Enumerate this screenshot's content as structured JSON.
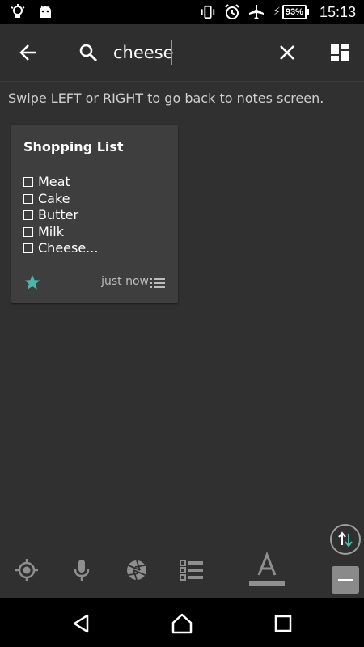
{
  "status_bar": {
    "left_icons": [
      "lightbulb-icon",
      "android-icon"
    ],
    "right_icons": [
      "vibrate-icon",
      "alarm-icon",
      "airplane-icon"
    ],
    "battery": "93%",
    "time": "15:13"
  },
  "toolbar": {
    "back_icon": "arrow-left-icon",
    "search_icon": "search-icon",
    "search_value": "cheese",
    "clear_icon": "close-icon",
    "layout_icon": "grid-layout-icon"
  },
  "hint": "Swipe LEFT or RIGHT to go back to notes screen.",
  "notes": [
    {
      "title": "Shopping List",
      "items": [
        "Meat",
        "Cake",
        "Butter",
        "Milk",
        "Cheese..."
      ],
      "starred": true,
      "time": "just now"
    }
  ],
  "colors": {
    "background": "#303030",
    "card": "#3e3e3e",
    "accent": "#4db6ac",
    "icon": "#8f8f8f"
  },
  "bottom_toolbar": [
    "location-target-icon",
    "microphone-icon",
    "camera-aperture-icon",
    "checklist-icon",
    "text-format-icon"
  ],
  "side_controls": [
    "sort-icon",
    "minus-icon"
  ],
  "nav_bar": [
    "back-triangle-icon",
    "home-icon",
    "recents-icon"
  ]
}
